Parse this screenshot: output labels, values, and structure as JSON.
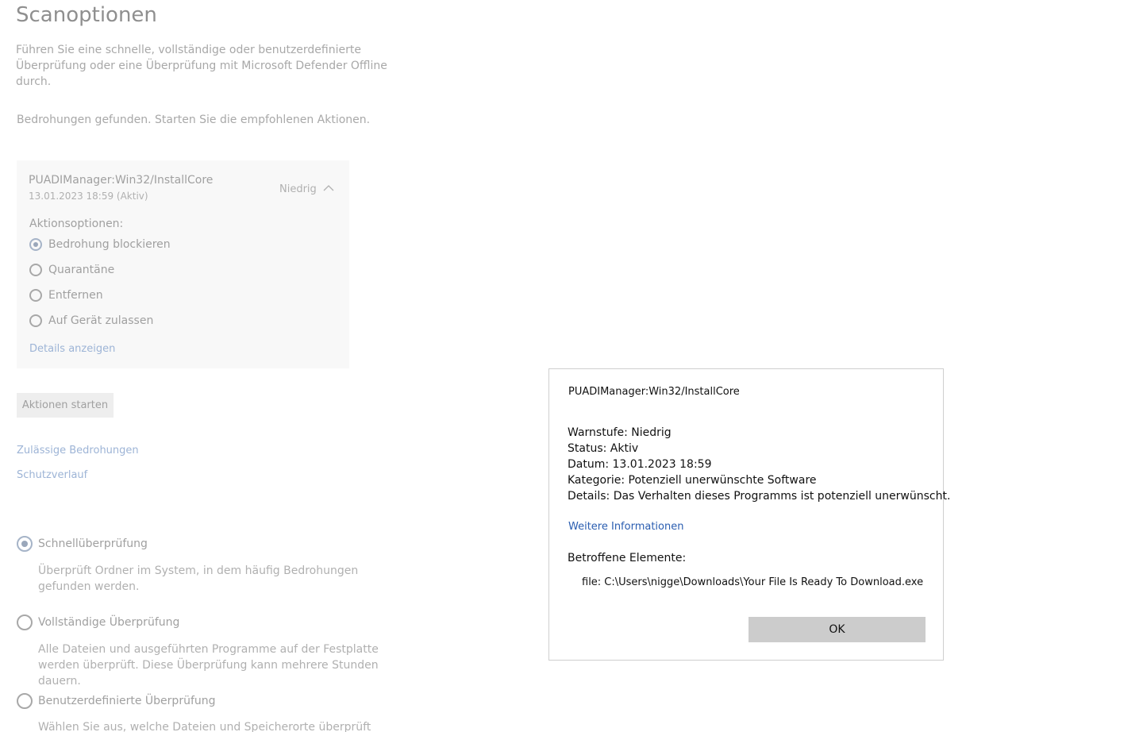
{
  "page": {
    "title": "Scanoptionen",
    "description": "Führen Sie eine schnelle, vollständige oder benutzerdefinierte Überprüfung oder eine Überprüfung mit Microsoft Defender Offline durch.",
    "threats_found_text": "Bedrohungen gefunden. Starten Sie die empfohlenen Aktionen."
  },
  "threat_card": {
    "name": "PUADIManager:Win32/InstallCore",
    "date_status": "13.01.2023 18:59 (Aktiv)",
    "severity": "Niedrig",
    "action_options_label": "Aktionsoptionen:",
    "options": [
      {
        "label": "Bedrohung blockieren",
        "selected": true
      },
      {
        "label": "Quarantäne",
        "selected": false
      },
      {
        "label": "Entfernen",
        "selected": false
      },
      {
        "label": "Auf Gerät zulassen",
        "selected": false
      }
    ],
    "details_link": "Details anzeigen"
  },
  "start_actions_button": "Aktionen starten",
  "links": {
    "allowed_threats": "Zulässige Bedrohungen",
    "protection_history": "Schutzverlauf"
  },
  "scan_options": [
    {
      "label": "Schnellüberprüfung",
      "selected": true,
      "description": "Überprüft Ordner im System, in dem häufig Bedrohungen gefunden werden."
    },
    {
      "label": "Vollständige Überprüfung",
      "selected": false,
      "description": "Alle Dateien und ausgeführten Programme auf der Festplatte werden überprüft. Diese Überprüfung kann mehrere Stunden dauern."
    },
    {
      "label": "Benutzerdefinierte Überprüfung",
      "selected": false,
      "description": "Wählen Sie aus, welche Dateien und Speicherorte überprüft werden"
    }
  ],
  "dialog": {
    "title": "PUADIManager:Win32/InstallCore",
    "alert_level": "Warnstufe: Niedrig",
    "status": "Status:  Aktiv",
    "date": "Datum:  13.01.2023 18:59",
    "category": "Kategorie:  Potenziell unerwünschte Software",
    "details": "Details:  Das Verhalten dieses Programms ist potenziell unerwünscht.",
    "more_info": "Weitere Informationen",
    "affected_items_label": "Betroffene Elemente:",
    "affected_file": "file: C:\\Users\\nigge\\Downloads\\Your File Is Ready To Download.exe",
    "ok_button": "OK"
  },
  "colors": {
    "link": "#9db4d6",
    "dialog_link": "#2a5db0",
    "muted_text": "#a0a0a0",
    "ok_button_bg": "#cccccc"
  }
}
